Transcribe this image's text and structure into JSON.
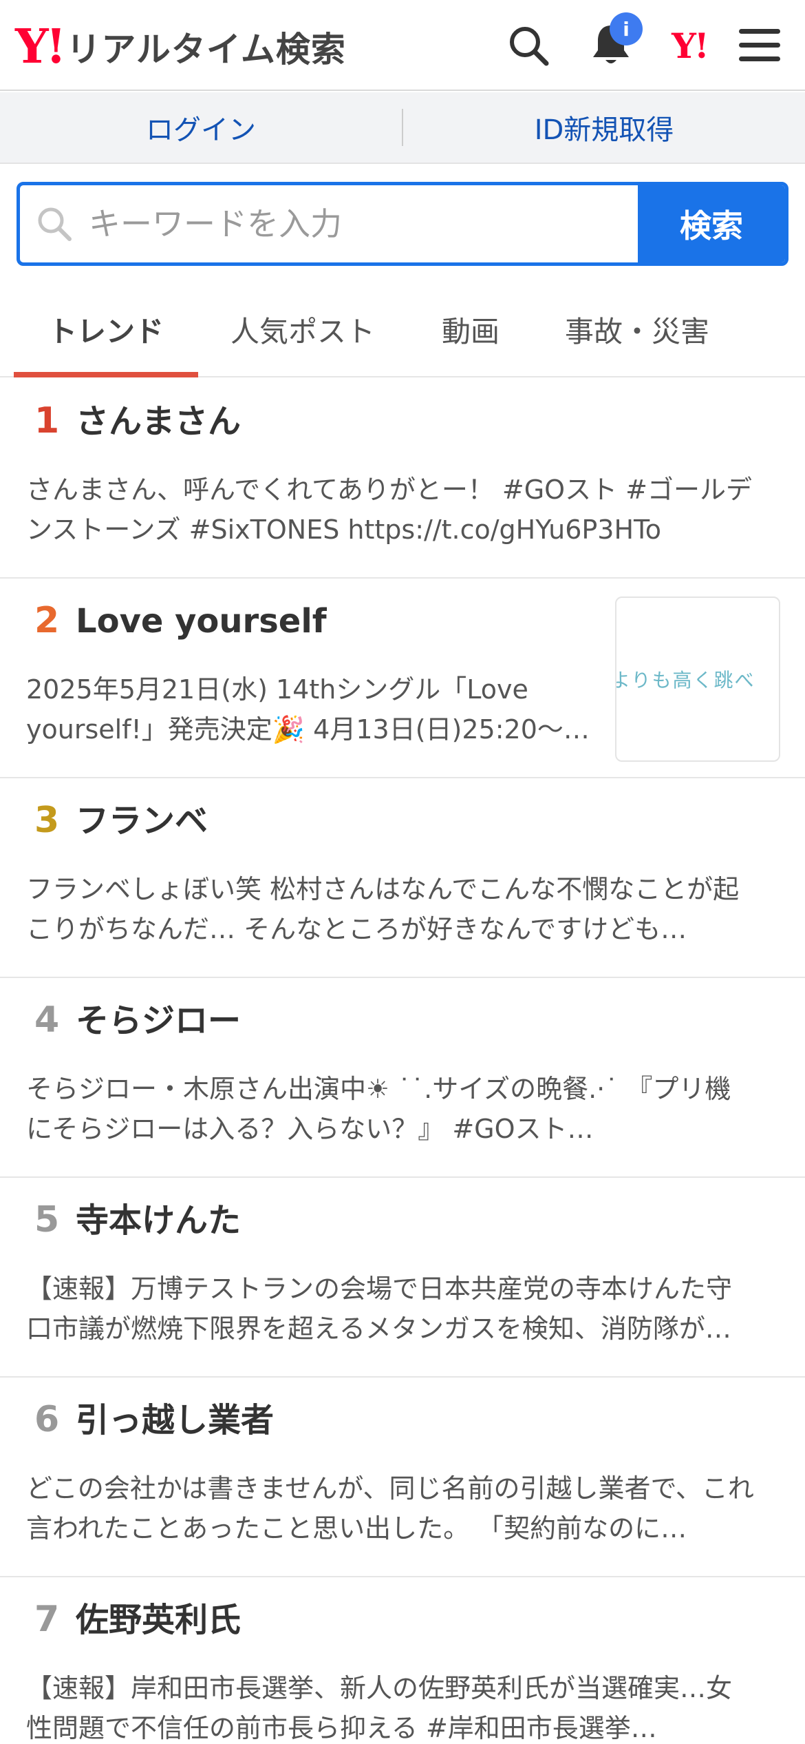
{
  "header": {
    "logo_mark": "Y!",
    "logo_text": "リアルタイム検索",
    "notification_badge": "i",
    "yj_mark": "Y!"
  },
  "account": {
    "login": "ログイン",
    "signup": "ID新規取得"
  },
  "search": {
    "placeholder": "キーワードを入力",
    "button": "検索"
  },
  "tabs": [
    {
      "label": "トレンド",
      "active": true
    },
    {
      "label": "人気ポスト",
      "active": false
    },
    {
      "label": "動画",
      "active": false
    },
    {
      "label": "事故・災害",
      "active": false
    }
  ],
  "colors": {
    "brand_red": "#ff0033",
    "accent_blue": "#1a73e8",
    "tab_underline": "#e0503f",
    "rank1": "#d9432f",
    "rank2": "#e8692e",
    "rank3": "#c49a1c",
    "rank_other": "#999999"
  },
  "trends": [
    {
      "rank": "1",
      "title": "さんまさん",
      "desc": "さんまさん、呼んでくれてありがとー！ #GOスト #ゴールデンストーンズ #SixTONES https://t.co/gHYu6P3HTo"
    },
    {
      "rank": "2",
      "title": "Love yourself",
      "desc": "2025年5月21日(水) 14thシングル「Love yourself!」発売決定🎉 4月13日(日)25:20〜…",
      "thumb_text": "よりも高く跳べ"
    },
    {
      "rank": "3",
      "title": "フランベ",
      "desc": "フランベしょぼい笑 松村さんはなんでこんな不憫なことが起こりがちなんだ… そんなところが好きなんですけども…"
    },
    {
      "rank": "4",
      "title": "そらジロー",
      "desc": "そらジロー・木原さん出演中☀ ˙˙.サイズの晩餐.·˙ 『プリ機にそらジローは入る？入らない？』 #GOスト…"
    },
    {
      "rank": "5",
      "title": "寺本けんた",
      "desc": "【速報】万博テストランの会場で日本共産党の寺本けんた守口市議が燃焼下限界を超えるメタンガスを検知、消防隊が…"
    },
    {
      "rank": "6",
      "title": "引っ越し業者",
      "desc": "どこの会社かは書きませんが、同じ名前の引越し業者で、これ言われたことあったこと思い出した。 「契約前なのに…"
    },
    {
      "rank": "7",
      "title": "佐野英利氏",
      "desc": "【速報】岸和田市長選挙、新人の佐野英利氏が当選確実…女性問題で不信任の前市長ら抑える #岸和田市長選挙…"
    }
  ]
}
